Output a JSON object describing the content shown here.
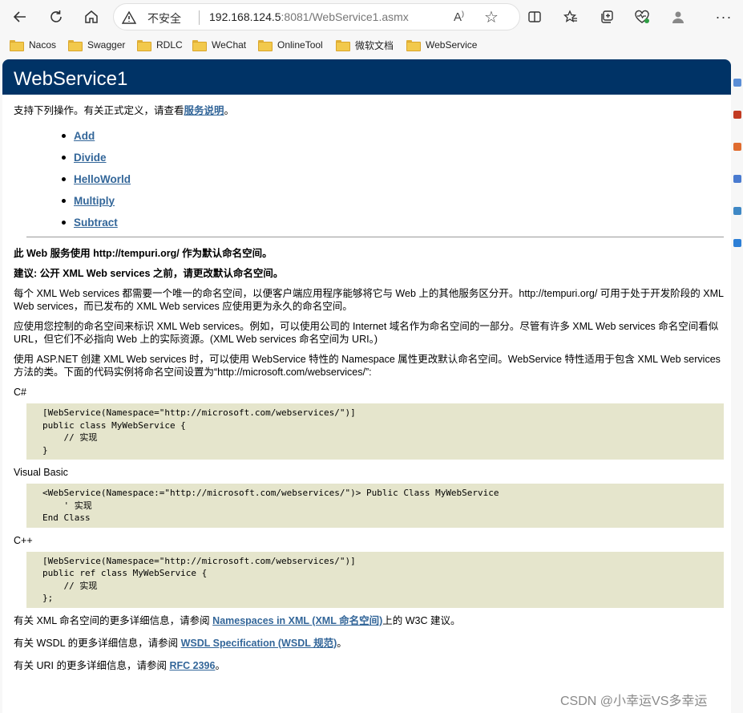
{
  "browser": {
    "insecure_label": "不安全",
    "url_host": "192.168.124.5",
    "url_rest": ":8081/WebService1.asmx",
    "read_aloud_label": "Ȃ",
    "bookmarks": [
      "Nacos",
      "Swagger",
      "RDLC",
      "WeChat",
      "OnlineTool",
      "微软文档",
      "WebService"
    ]
  },
  "page": {
    "title": "WebService1",
    "intro_text": "支持下列操作。有关正式定义，请查看",
    "intro_link": "服务说明",
    "intro_end": "。",
    "operations": [
      "Add",
      "Divide",
      "HelloWorld",
      "Multiply",
      "Subtract"
    ],
    "ns_notice": "此 Web 服务使用 http://tempuri.org/ 作为默认命名空间。",
    "recommend": "建议: 公开 XML Web services 之前，请更改默认命名空间。",
    "para1": "每个 XML Web services 都需要一个唯一的命名空间，以便客户端应用程序能够将它与 Web 上的其他服务区分开。http://tempuri.org/ 可用于处于开发阶段的 XML Web services，而已发布的 XML Web services 应使用更为永久的命名空间。",
    "para2": "应使用您控制的命名空间来标识 XML Web services。例如，可以使用公司的 Internet 域名作为命名空间的一部分。尽管有许多 XML Web services 命名空间看似 URL，但它们不必指向 Web 上的实际资源。(XML Web services 命名空间为 URI。)",
    "para3": "使用 ASP.NET 创建 XML Web services 时，可以使用 WebService 特性的 Namespace 属性更改默认命名空间。WebService 特性适用于包含 XML Web services 方法的类。下面的代码实例将命名空间设置为“http://microsoft.com/webservices/”:",
    "lang_cs": "C#",
    "code_cs": "[WebService(Namespace=\"http://microsoft.com/webservices/\")]\npublic class MyWebService {\n    // 实现\n}",
    "lang_vb": "Visual Basic",
    "code_vb": "<WebService(Namespace:=\"http://microsoft.com/webservices/\")> Public Class MyWebService\n    ' 实现\nEnd Class",
    "lang_cpp": "C++",
    "code_cpp": "[WebService(Namespace=\"http://microsoft.com/webservices/\")]\npublic ref class MyWebService {\n    // 实现\n};",
    "xmlns_pre": "有关 XML 命名空间的更多详细信息，请参阅 ",
    "xmlns_link": "Namespaces in XML (XML 命名空间)",
    "xmlns_post": "上的 W3C 建议。",
    "wsdl_pre": "有关 WSDL 的更多详细信息，请参阅 ",
    "wsdl_link": "WSDL Specification (WSDL 规范)",
    "wsdl_post": "。",
    "uri_pre": "有关 URI 的更多详细信息，请参阅 ",
    "uri_link": "RFC 2396",
    "uri_post": "。"
  },
  "watermark": "CSDN @小幸运VS多幸运"
}
